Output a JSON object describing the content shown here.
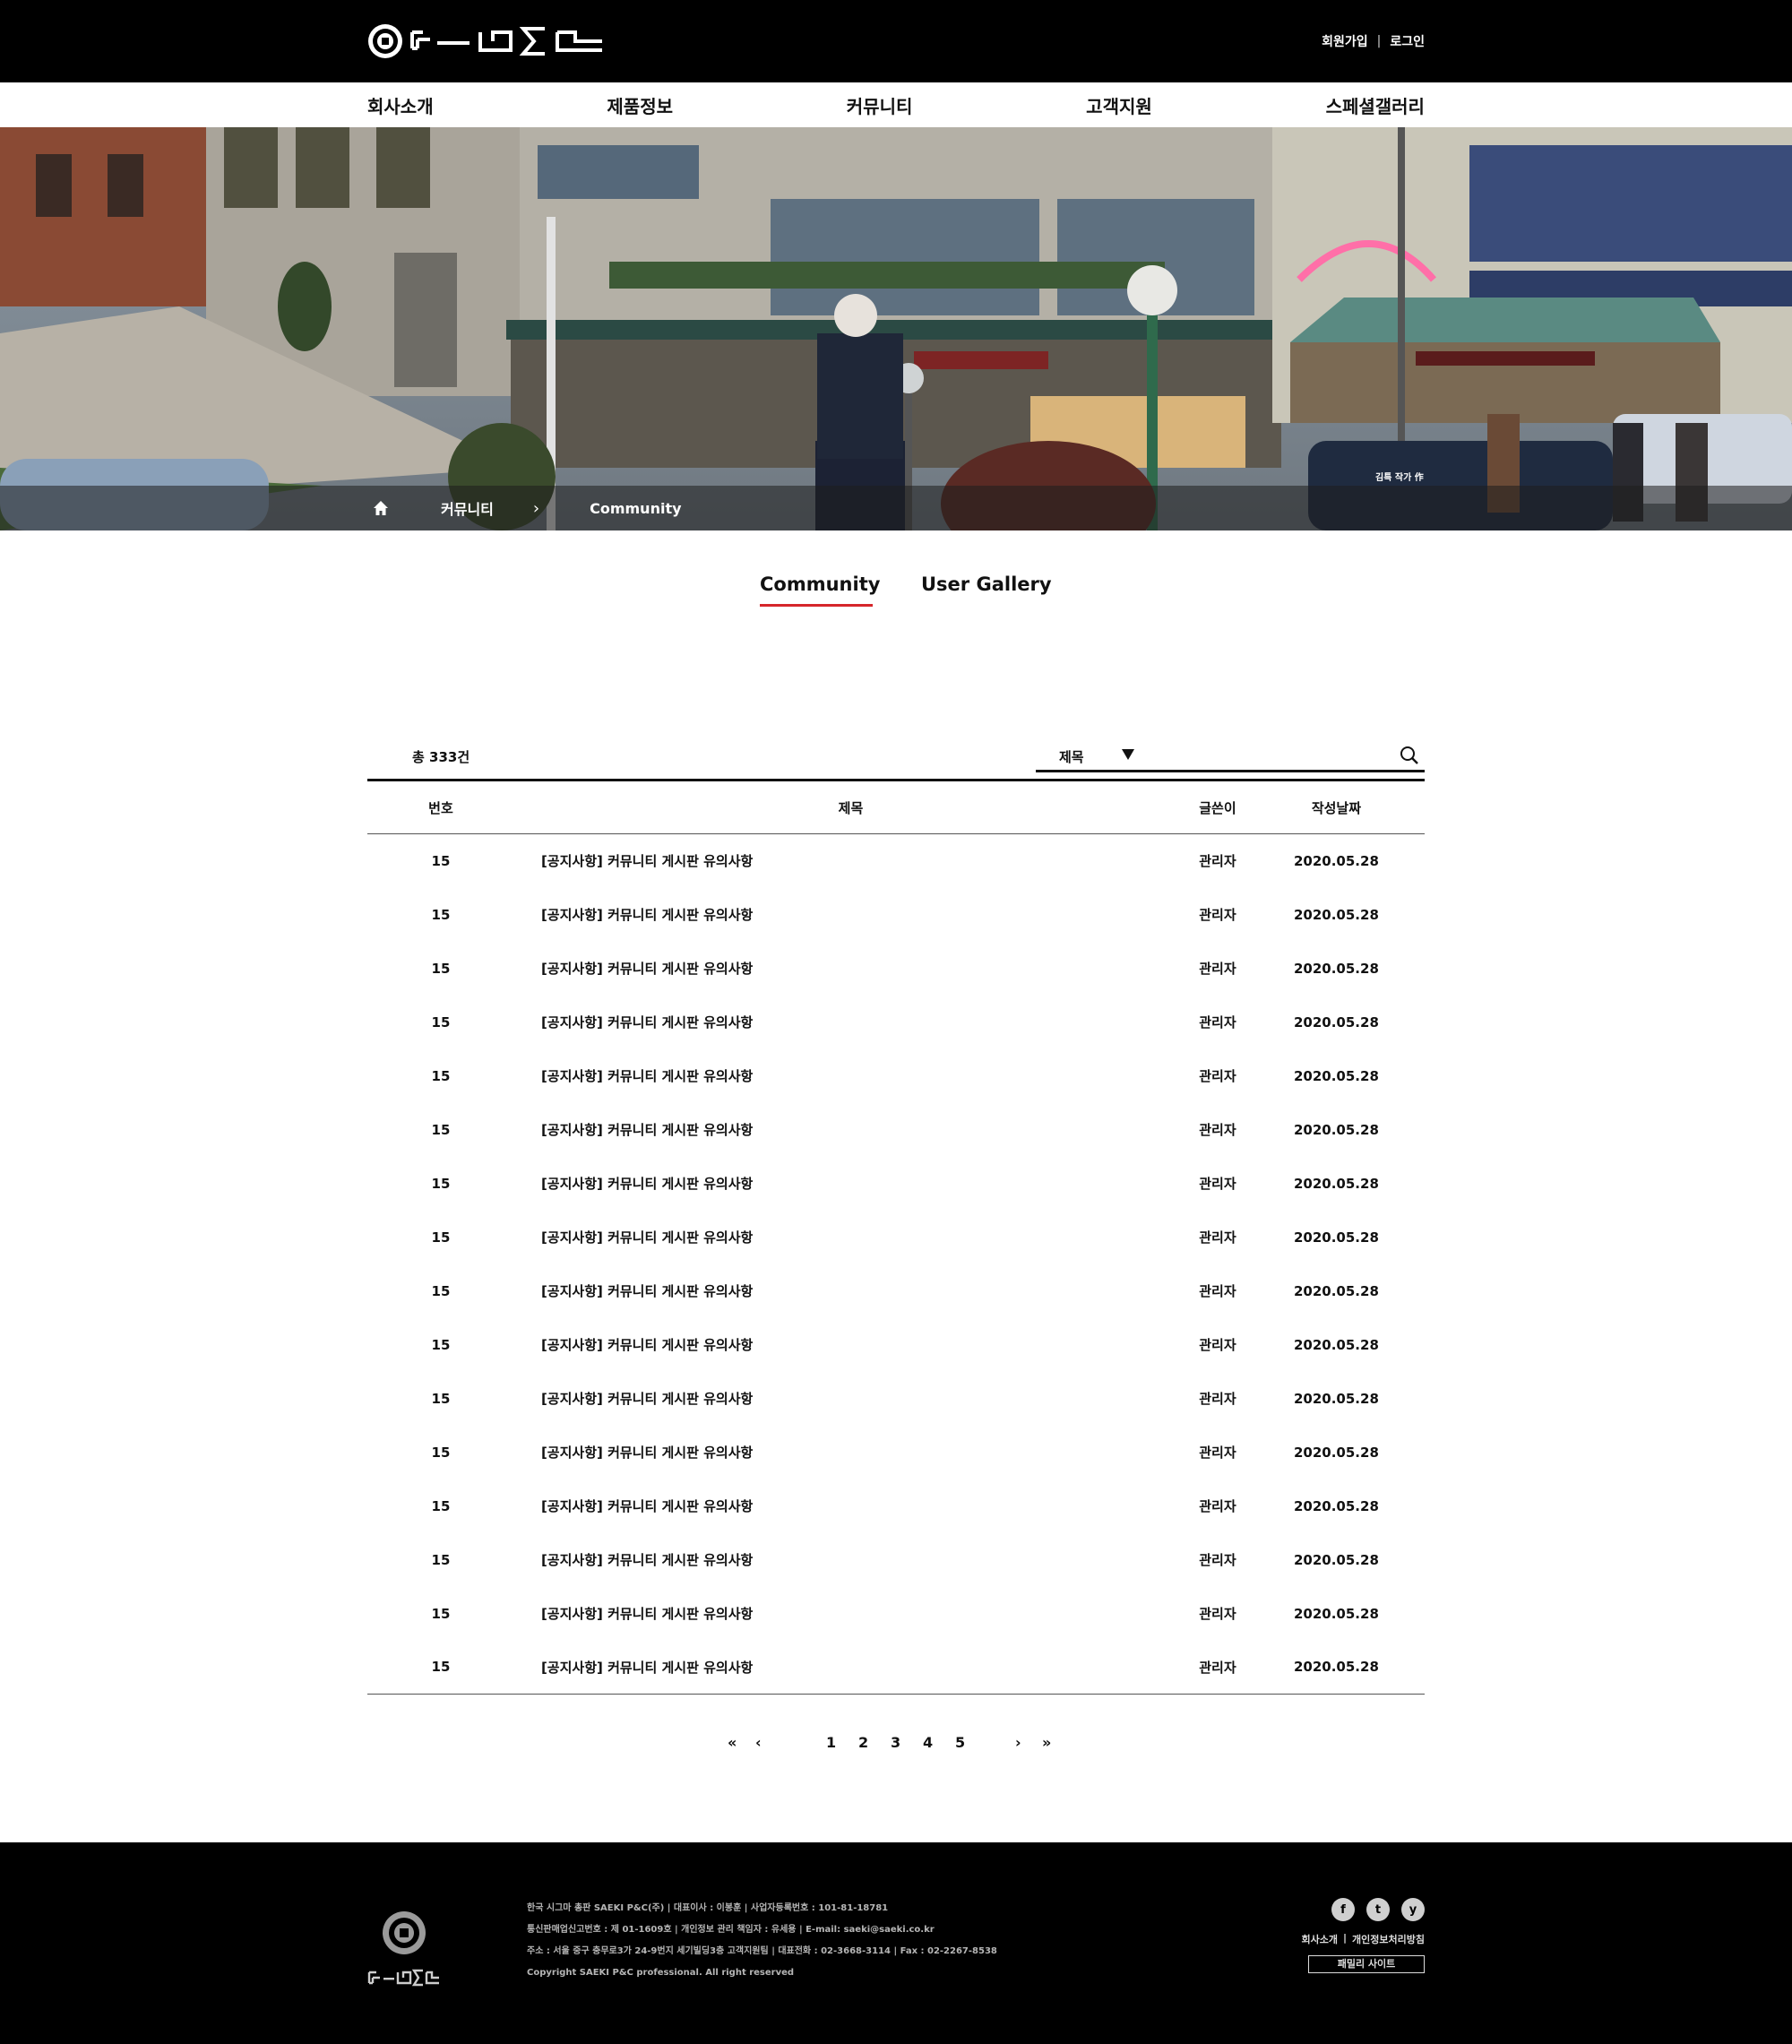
{
  "header": {
    "links": [
      "회원가입",
      "로그인"
    ]
  },
  "nav": [
    "회사소개",
    "제품정보",
    "커뮤니티",
    "고객지원",
    "스페셜갤러리"
  ],
  "hero": {
    "breadcrumb": [
      "커뮤니티",
      "Community"
    ],
    "photo_credit": "김특 작가 作"
  },
  "tabs": [
    "Community",
    "User Gallery"
  ],
  "board": {
    "total": "총 333건",
    "search_option": "제목",
    "search_placeholder": "",
    "columns": [
      "번호",
      "제목",
      "글쓴이",
      "작성날짜"
    ],
    "rows": [
      {
        "num": "15",
        "title": "[공지사항] 커뮤니티 게시판 유의사항",
        "writer": "관리자",
        "date": "2020.05.28"
      },
      {
        "num": "15",
        "title": "[공지사항] 커뮤니티 게시판 유의사항",
        "writer": "관리자",
        "date": "2020.05.28"
      },
      {
        "num": "15",
        "title": "[공지사항] 커뮤니티 게시판 유의사항",
        "writer": "관리자",
        "date": "2020.05.28"
      },
      {
        "num": "15",
        "title": "[공지사항] 커뮤니티 게시판 유의사항",
        "writer": "관리자",
        "date": "2020.05.28"
      },
      {
        "num": "15",
        "title": "[공지사항] 커뮤니티 게시판 유의사항",
        "writer": "관리자",
        "date": "2020.05.28"
      },
      {
        "num": "15",
        "title": "[공지사항] 커뮤니티 게시판 유의사항",
        "writer": "관리자",
        "date": "2020.05.28"
      },
      {
        "num": "15",
        "title": "[공지사항] 커뮤니티 게시판 유의사항",
        "writer": "관리자",
        "date": "2020.05.28"
      },
      {
        "num": "15",
        "title": "[공지사항] 커뮤니티 게시판 유의사항",
        "writer": "관리자",
        "date": "2020.05.28"
      },
      {
        "num": "15",
        "title": "[공지사항] 커뮤니티 게시판 유의사항",
        "writer": "관리자",
        "date": "2020.05.28"
      },
      {
        "num": "15",
        "title": "[공지사항] 커뮤니티 게시판 유의사항",
        "writer": "관리자",
        "date": "2020.05.28"
      },
      {
        "num": "15",
        "title": "[공지사항] 커뮤니티 게시판 유의사항",
        "writer": "관리자",
        "date": "2020.05.28"
      },
      {
        "num": "15",
        "title": "[공지사항] 커뮤니티 게시판 유의사항",
        "writer": "관리자",
        "date": "2020.05.28"
      },
      {
        "num": "15",
        "title": "[공지사항] 커뮤니티 게시판 유의사항",
        "writer": "관리자",
        "date": "2020.05.28"
      },
      {
        "num": "15",
        "title": "[공지사항] 커뮤니티 게시판 유의사항",
        "writer": "관리자",
        "date": "2020.05.28"
      },
      {
        "num": "15",
        "title": "[공지사항] 커뮤니티 게시판 유의사항",
        "writer": "관리자",
        "date": "2020.05.28"
      },
      {
        "num": "15",
        "title": "[공지사항] 커뮤니티 게시판 유의사항",
        "writer": "관리자",
        "date": "2020.05.28"
      }
    ]
  },
  "pagination": {
    "first": "«",
    "prev": "‹",
    "pages": [
      "1",
      "2",
      "3",
      "4",
      "5"
    ],
    "next": "›",
    "last": "»"
  },
  "footer": {
    "info": [
      "한국 시그마 총판 SAEKI P&C(주) | 대표이사 : 이봉훈 | 사업자등록번호 : 101-81-18781",
      "통신판매업신고번호 : 제 01-1609호 | 개인정보 관리 책임자 : 유세용 | E-mail: saeki@saeki.co.kr",
      "주소 : 서울 중구 충무로3가 24-9번지 세기빌딩3층 고객지원팀 | 대표전화 : 02-3668-3114 | Fax : 02-2267-8538",
      "Copyright SAEKI P&C professional. All right reserved"
    ],
    "social": [
      "f",
      "t",
      "y"
    ],
    "social_icons": [
      "facebook-icon",
      "twitter-icon",
      "youtube-icon"
    ],
    "links": [
      "회사소개",
      "개인정보처리방침"
    ],
    "family_site": "패밀리 사이트"
  },
  "colors": {
    "accent": "#d6262b",
    "header_bg": "#000000",
    "footer_bg": "#000000"
  }
}
